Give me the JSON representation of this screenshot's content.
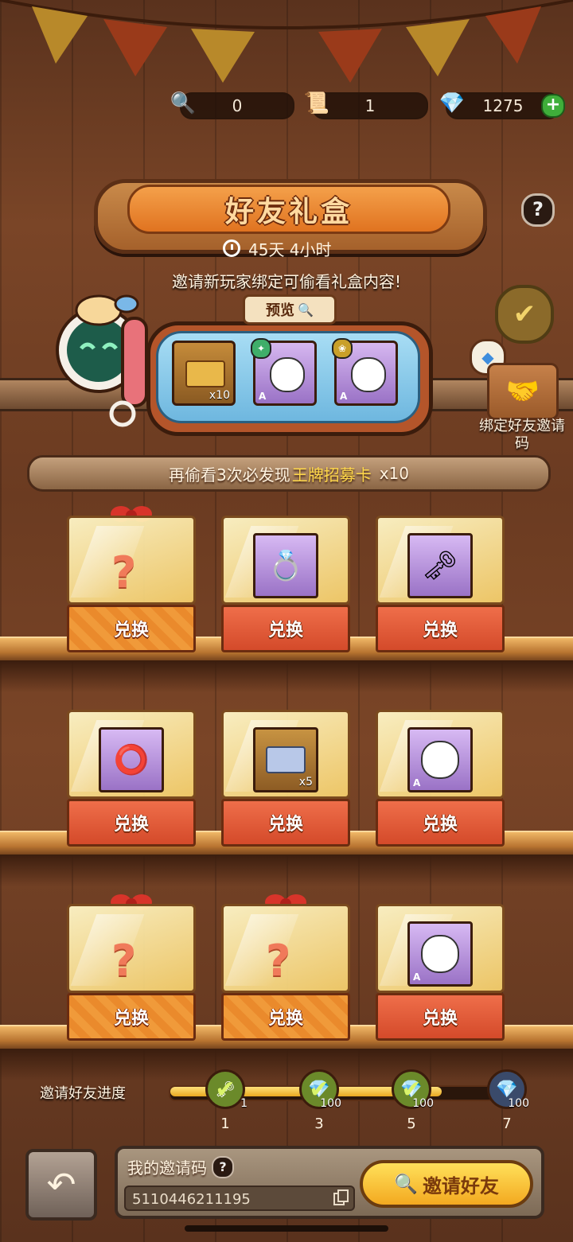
{
  "hud": {
    "magnifier_count": "0",
    "scroll_count": "1",
    "gem_count": "1275"
  },
  "header": {
    "title": "好友礼盒",
    "help": "?",
    "timer": "45天  4小时",
    "invite_hint": "邀请新玩家绑定可偷看礼盒内容!"
  },
  "preview": {
    "tag": "预览",
    "items": [
      {
        "kind": "ticket",
        "qty": "x10"
      },
      {
        "kind": "character-duck",
        "grade": "A"
      },
      {
        "kind": "character-dog",
        "grade": "A"
      }
    ]
  },
  "bind": {
    "label": "绑定好友邀请码"
  },
  "banner": {
    "prefix": "再偷看3次必发现",
    "highlight": "王牌招募卡",
    "suffix": "x10"
  },
  "rewards": {
    "exchange_label": "兑换",
    "rows": [
      [
        {
          "type": "mystery"
        },
        {
          "type": "ring"
        },
        {
          "type": "key"
        }
      ],
      [
        {
          "type": "bracelet"
        },
        {
          "type": "ticket",
          "qty": "x5"
        },
        {
          "type": "character-dog",
          "grade": "A"
        }
      ],
      [
        {
          "type": "mystery"
        },
        {
          "type": "mystery"
        },
        {
          "type": "character-duck",
          "grade": "A"
        }
      ]
    ]
  },
  "progress": {
    "label": "邀请好友进度",
    "fill_fraction": 0.8,
    "milestones": [
      {
        "count": "1",
        "reward": "1",
        "done": true
      },
      {
        "count": "3",
        "reward": "100",
        "done": true
      },
      {
        "count": "5",
        "reward": "100",
        "done": true
      },
      {
        "count": "7",
        "reward": "100",
        "done": false
      }
    ]
  },
  "invite": {
    "title": "我的邀请码",
    "code": "5110446211195",
    "button": "邀请好友"
  },
  "colors": {
    "accent": "#f3a920",
    "highlight": "#ffd84a",
    "button_red": "#d44a2a",
    "button_orange": "#f09a3a"
  }
}
